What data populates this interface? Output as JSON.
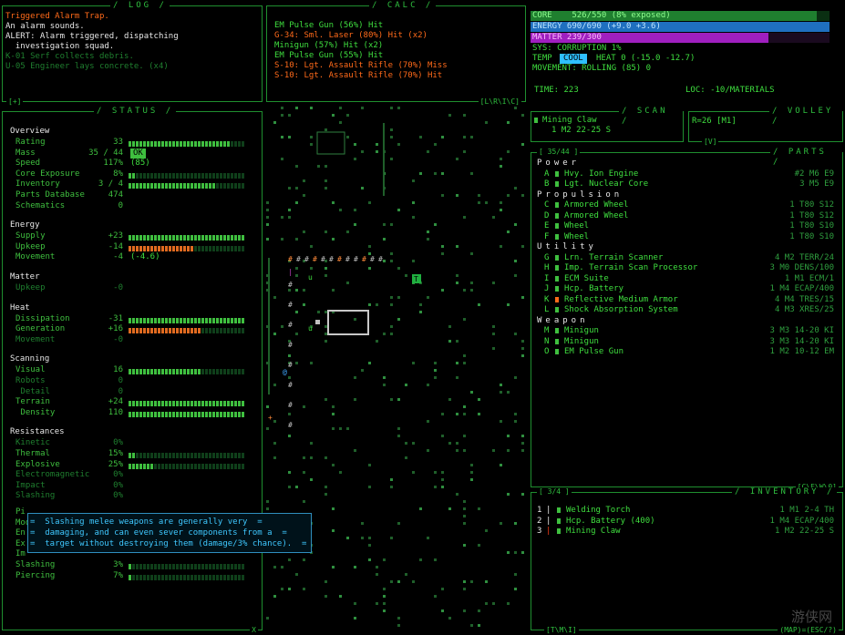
{
  "log": {
    "title": "/ LOG /",
    "corner": "[+]",
    "lines": [
      {
        "text": "Triggered Alarm Trap.",
        "color": "orange"
      },
      {
        "text": "An alarm sounds.",
        "color": "white"
      },
      {
        "text": "ALERT: Alarm triggered, dispatching",
        "color": "white"
      },
      {
        "text": "  investigation squad.",
        "color": "white"
      },
      {
        "text": "K-01 Serf collects debris.",
        "color": "dim"
      },
      {
        "text": "U-05 Engineer lays concrete. (x4)",
        "color": "dim"
      }
    ]
  },
  "calc": {
    "title": "/ CALC /",
    "corner": "[L\\R\\I\\C]",
    "lines": [
      {
        "text": "EM Pulse Gun (56%) Hit",
        "color": "green"
      },
      {
        "text": "G-34: Sml. Laser (80%) Hit (x2)",
        "color": "orange"
      },
      {
        "text": "Minigun (57%) Hit (x2)",
        "color": "green"
      },
      {
        "text": "EM Pulse Gun (55%) Hit",
        "color": "green"
      },
      {
        "text": "S-10: Lgt. Assault Rifle (70%) Miss",
        "color": "orange"
      },
      {
        "text": "S-10: Lgt. Assault Rifle (70%) Hit",
        "color": "orange"
      }
    ]
  },
  "core": {
    "core": "CORE    526/550 (8% exposed)",
    "energy": "ENERGY 690/690 (+9.0 +3.6)",
    "matter": "MATTER 239/300",
    "sys": "SYS: CORRUPTION 1%",
    "temp_label": "TEMP",
    "temp_state": "COOL",
    "temp_rest": "HEAT 0 (-15.0 -12.7)",
    "movement": "MOVEMENT: ROLLING (85) 0",
    "time": "TIME: 223",
    "loc": "LOC: -10/MATERIALS",
    "core_pct": 0.956,
    "energy_pct": 1.0,
    "matter_pct": 0.797
  },
  "scan": {
    "title": "/ SCAN /",
    "item": "Mining Claw",
    "sub": "1 M2 22-25 S"
  },
  "volley": {
    "title": "/ VOLLEY /",
    "text": "R=26 [M1]",
    "corner": "[V]"
  },
  "status": {
    "title": "/ STATUS /",
    "corner": "X",
    "sections": [
      {
        "head": "Overview",
        "rows": [
          {
            "l": "Rating",
            "v": "33",
            "bar": "g",
            "n": 28
          },
          {
            "l": "Mass",
            "v": "35 / 44",
            "badge": "OK"
          },
          {
            "l": "Speed",
            "v": "117%",
            "extra": "(85)"
          },
          {
            "l": "Core Exposure",
            "v": "8%",
            "bar": "g",
            "n": 2
          },
          {
            "l": "Inventory",
            "v": "3 / 4",
            "bar": "g",
            "n": 24
          },
          {
            "l": "Parts Database",
            "v": "474"
          },
          {
            "l": "Schematics",
            "v": "0"
          }
        ]
      },
      {
        "head": "Energy",
        "rows": [
          {
            "l": "Supply",
            "v": "+23",
            "bar": "g",
            "n": 32
          },
          {
            "l": "Upkeep",
            "v": "-14",
            "bar": "o",
            "n": 18
          },
          {
            "l": "Movement",
            "v": "-4",
            "extra": "(-4.6)"
          }
        ]
      },
      {
        "head": "Matter",
        "rows": [
          {
            "l": "Upkeep",
            "v": "-0",
            "dim": true
          }
        ]
      },
      {
        "head": "Heat",
        "rows": [
          {
            "l": "Dissipation",
            "v": "-31",
            "bar": "g",
            "n": 32
          },
          {
            "l": "Generation",
            "v": "+16",
            "bar": "o",
            "n": 20
          },
          {
            "l": "Movement",
            "v": "-0",
            "dim": true
          }
        ]
      },
      {
        "head": "Scanning",
        "rows": [
          {
            "l": "Visual",
            "v": "16",
            "bar": "g",
            "n": 20
          },
          {
            "l": "Robots",
            "v": "0",
            "dim": true
          },
          {
            "l": " Detail",
            "v": "0",
            "dim": true
          },
          {
            "l": "Terrain",
            "v": "+24",
            "bar": "g",
            "n": 32
          },
          {
            "l": " Density",
            "v": "110",
            "bar": "g",
            "n": 32
          }
        ]
      },
      {
        "head": "Resistances",
        "rows": [
          {
            "l": "Kinetic",
            "v": "0%",
            "dim": true
          },
          {
            "l": "Thermal",
            "v": "15%",
            "bar": "g",
            "n": 2
          },
          {
            "l": "Explosive",
            "v": "25%",
            "bar": "g",
            "n": 7
          },
          {
            "l": "Electromagnetic",
            "v": "0%",
            "dim": true
          },
          {
            "l": "Impact",
            "v": "0%",
            "dim": true
          },
          {
            "l": "Slashing",
            "v": "0%",
            "dim": true
          }
        ]
      }
    ],
    "lower": [
      {
        "l": "Pi",
        "v": ""
      },
      {
        "l": "Mod",
        "v": ""
      },
      {
        "l": "En",
        "v": ""
      },
      {
        "l": "Ex",
        "v": ""
      },
      {
        "l": "Im",
        "v": ""
      },
      {
        "l": "Slashing",
        "v": "3%",
        "bar": "g",
        "n": 1
      },
      {
        "l": "Piercing",
        "v": "7%",
        "bar": "g",
        "n": 1
      }
    ]
  },
  "tooltip": {
    "lines": [
      "Slashing melee weapons are generally very",
      "damaging, and can even sever components from a",
      "target without destroying them (damage/3% chance)."
    ]
  },
  "parts": {
    "title": "/ PARTS /",
    "count": "[ 35/44 ]",
    "groups": [
      {
        "name": "Power",
        "items": [
          {
            "k": "A",
            "n": "Hvy. Ion Engine",
            "s": "#2 M6 E9"
          },
          {
            "k": "B",
            "n": "Lgt. Nuclear Core",
            "s": "3 M5 E9"
          }
        ]
      },
      {
        "name": "Propulsion",
        "items": [
          {
            "k": "C",
            "n": "Armored Wheel",
            "s": "1 T80 S12"
          },
          {
            "k": "D",
            "n": "Armored Wheel",
            "s": "1 T80 S12"
          },
          {
            "k": "E",
            "n": "Wheel",
            "s": "1 T80 S10"
          },
          {
            "k": "F",
            "n": "Wheel",
            "s": "1 T80 S10"
          }
        ]
      },
      {
        "name": "Utility",
        "items": [
          {
            "k": "G",
            "n": "Lrn. Terrain Scanner",
            "s": "4 M2 TERR/24"
          },
          {
            "k": "H",
            "n": "Imp. Terrain Scan Processor",
            "s": "3 M0 DENS/100"
          },
          {
            "k": "I",
            "n": "ECM Suite",
            "s": "1 M1 ECM/1"
          },
          {
            "k": "J",
            "n": "Hcp. Battery",
            "s": "1 M4 ECAP/400"
          },
          {
            "k": "K",
            "n": "Reflective Medium Armor",
            "s": "4 M4 TRES/15",
            "orange": true
          },
          {
            "k": "L",
            "n": "Shock Absorption System",
            "s": "4 M3 XRES/25"
          }
        ]
      },
      {
        "name": "Weapon",
        "items": [
          {
            "k": "M",
            "n": "Minigun",
            "s": "3 M3 14-20 KI"
          },
          {
            "k": "N",
            "n": "Minigun",
            "s": "3 M3 14-20 KI"
          },
          {
            "k": "O",
            "n": "EM Pulse Gun",
            "s": "1 M2 10-12 EM"
          }
        ]
      }
    ],
    "corner": "[C\\E\\W\\0]"
  },
  "inventory": {
    "title": "/ INVENTORY /",
    "count": "[ 3/4 ]",
    "items": [
      {
        "k": "1",
        "n": "Welding Torch",
        "s": "1 M1 2-4 TH"
      },
      {
        "k": "2",
        "n": "Hcp. Battery (400)",
        "s": "1 M4 ECAP/400"
      },
      {
        "k": "3",
        "n": "Mining Claw",
        "s": "1 M2 22-25 S",
        "orange": true
      }
    ],
    "corner": "[T\\M\\I]"
  },
  "footer": {
    "right": "(MAP)=(ESC/?)"
  },
  "watermark": "游侠网"
}
